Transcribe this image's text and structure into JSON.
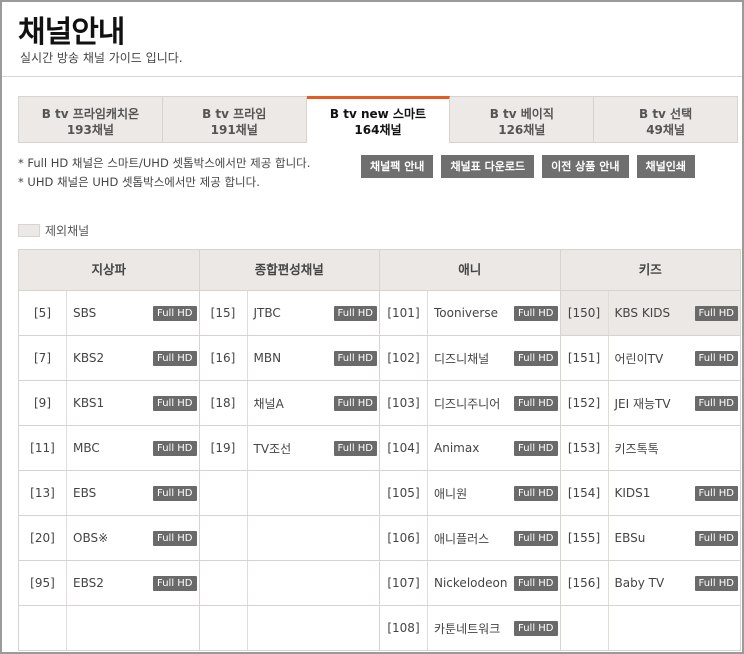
{
  "page": {
    "title": "채널안내",
    "subtitle": "실시간 방송 채널 가이드 입니다."
  },
  "tabs": [
    {
      "label": "B tv 프라임캐치온",
      "count": "193채널",
      "active": false
    },
    {
      "label": "B tv 프라임",
      "count": "191채널",
      "active": false
    },
    {
      "label": "B tv new 스마트",
      "count": "164채널",
      "active": true
    },
    {
      "label": "B tv 베이직",
      "count": "126채널",
      "active": false
    },
    {
      "label": "B tv 선택",
      "count": "49채널",
      "active": false
    }
  ],
  "notes": [
    "* Full HD 채널은 스마트/UHD 셋톱박스에서만 제공 합니다.",
    "* UHD 채널은 UHD 셋톱박스에서만 제공 합니다."
  ],
  "buttons": {
    "guide": "채널팩 안내",
    "download": "채널표 다운로드",
    "previous": "이전 상품 안내",
    "print": "채널인쇄"
  },
  "legend": {
    "label": "제외채널"
  },
  "badge_label": "Full HD",
  "colors": {
    "accent": "#e85a1f",
    "badge": "#6a6a6a",
    "header_bg": "#ebe8e5"
  },
  "columns": [
    {
      "header": "지상파",
      "channels": [
        {
          "num": "[5]",
          "name": "SBS",
          "fullhd": true
        },
        {
          "num": "[7]",
          "name": "KBS2",
          "fullhd": true
        },
        {
          "num": "[9]",
          "name": "KBS1",
          "fullhd": true
        },
        {
          "num": "[11]",
          "name": "MBC",
          "fullhd": true
        },
        {
          "num": "[13]",
          "name": "EBS",
          "fullhd": true
        },
        {
          "num": "[20]",
          "name": "OBS※",
          "fullhd": true
        },
        {
          "num": "[95]",
          "name": "EBS2",
          "fullhd": true
        }
      ]
    },
    {
      "header": "종합편성채널",
      "channels": [
        {
          "num": "[15]",
          "name": "JTBC",
          "fullhd": true
        },
        {
          "num": "[16]",
          "name": "MBN",
          "fullhd": true
        },
        {
          "num": "[18]",
          "name": "채널A",
          "fullhd": true
        },
        {
          "num": "[19]",
          "name": "TV조선",
          "fullhd": true
        }
      ]
    },
    {
      "header": "애니",
      "channels": [
        {
          "num": "[101]",
          "name": "Tooniverse",
          "fullhd": true
        },
        {
          "num": "[102]",
          "name": "디즈니채널",
          "fullhd": true
        },
        {
          "num": "[103]",
          "name": "디즈니주니어",
          "fullhd": true
        },
        {
          "num": "[104]",
          "name": "Animax",
          "fullhd": true
        },
        {
          "num": "[105]",
          "name": "애니원",
          "fullhd": true
        },
        {
          "num": "[106]",
          "name": "애니플러스",
          "fullhd": true
        },
        {
          "num": "[107]",
          "name": "Nickelodeon",
          "fullhd": true
        },
        {
          "num": "[108]",
          "name": "카툰네트워크",
          "fullhd": true
        }
      ]
    },
    {
      "header": "키즈",
      "channels": [
        {
          "num": "[150]",
          "name": "KBS KIDS",
          "fullhd": true,
          "excluded": true
        },
        {
          "num": "[151]",
          "name": "어린이TV",
          "fullhd": true
        },
        {
          "num": "[152]",
          "name": "JEI 재능TV",
          "fullhd": true
        },
        {
          "num": "[153]",
          "name": "키즈톡톡",
          "fullhd": false
        },
        {
          "num": "[154]",
          "name": "KIDS1",
          "fullhd": true
        },
        {
          "num": "[155]",
          "name": "EBSu",
          "fullhd": true
        },
        {
          "num": "[156]",
          "name": "Baby TV",
          "fullhd": true
        }
      ]
    }
  ]
}
